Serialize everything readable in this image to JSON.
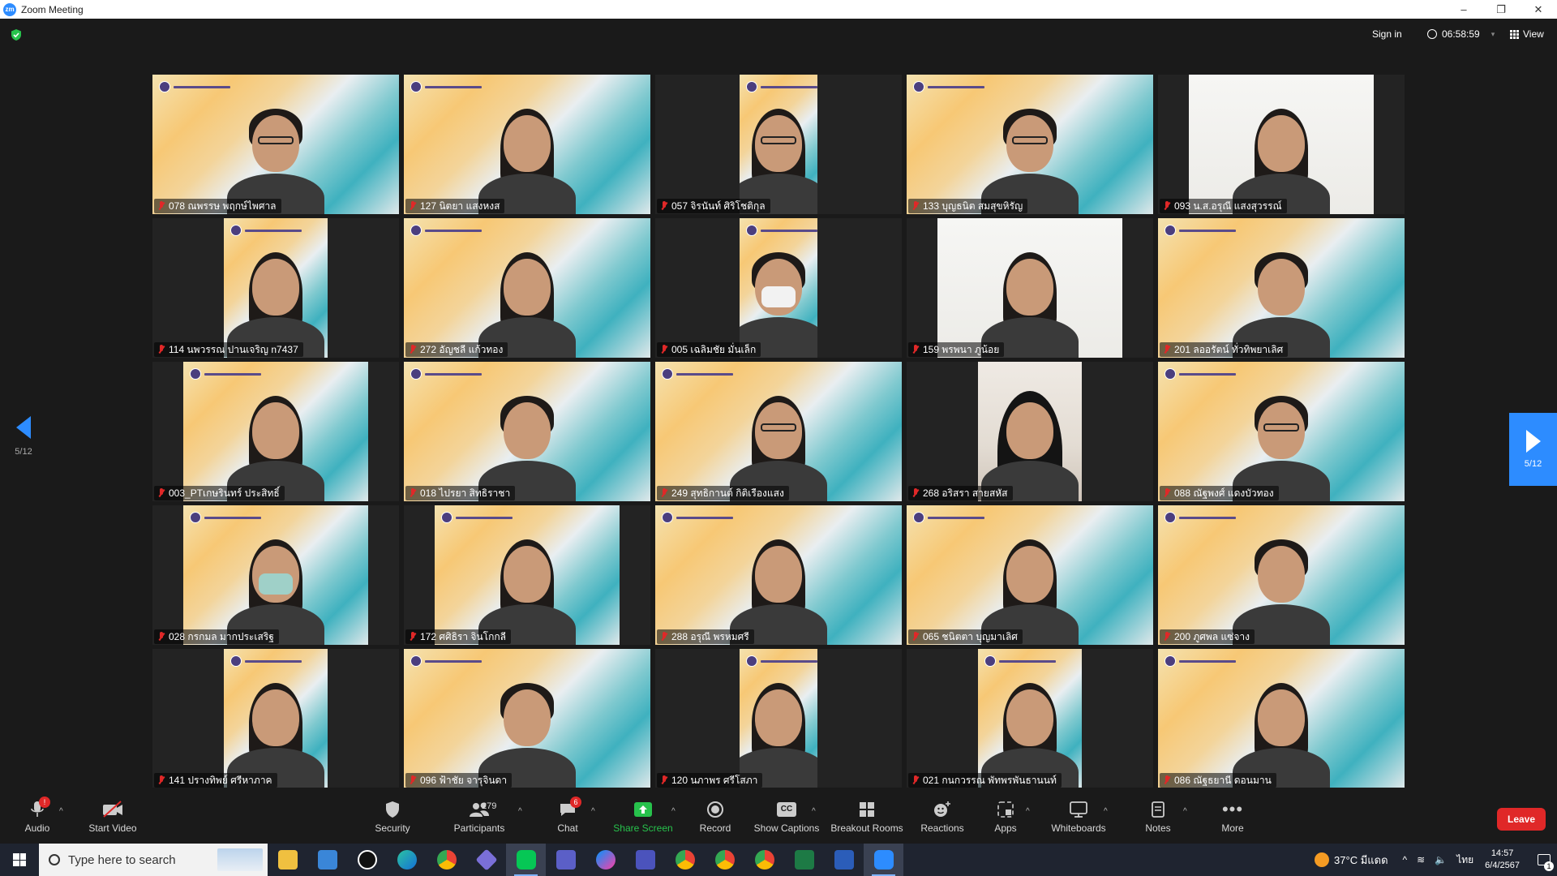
{
  "window": {
    "title": "Zoom Meeting",
    "app_icon_text": "zm"
  },
  "topbar": {
    "sign_in": "Sign in",
    "timer": "06:58:59",
    "view_label": "View"
  },
  "pagination": {
    "prev_label": "5/12",
    "next_label": "5/12"
  },
  "participants": [
    {
      "name": "078 ณพรรษ พฤกษ์ไพศาล",
      "bg": "zoom",
      "frame": "full",
      "look": "short glasses"
    },
    {
      "name": "127 นิตยา  แสงหงส",
      "bg": "zoom",
      "frame": "full",
      "look": "long"
    },
    {
      "name": "057 จิรนันท์ ศิริโชติกุล",
      "bg": "zoom",
      "frame": "narrow",
      "look": "long glasses"
    },
    {
      "name": "133 บุญธนิต สมสุขหิรัญ",
      "bg": "zoom",
      "frame": "full",
      "look": "short glasses"
    },
    {
      "name": "093 น.ส.อรุณี แสงสุวรรณ์",
      "bg": "white",
      "frame": "mid",
      "look": "long"
    },
    {
      "name": "114 นพวรรณ ปานเจริญ n7437",
      "bg": "zoom",
      "frame": "mid-sm",
      "look": "long"
    },
    {
      "name": "272 อัญชลี แก้วทอง",
      "bg": "zoom",
      "frame": "full",
      "look": "long"
    },
    {
      "name": "005 เฉลิมชัย มั่นเล็ก",
      "bg": "zoom",
      "frame": "narrow",
      "look": "short mask-white"
    },
    {
      "name": "159 พรพนา ภูน้อย",
      "bg": "white",
      "frame": "mid",
      "look": "long"
    },
    {
      "name": "201 ลออรัตน์ ทั่วทิพยาเลิศ",
      "bg": "zoom",
      "frame": "full",
      "look": "short"
    },
    {
      "name": "003_PTเกษรินทร์ ประสิทธิ์",
      "bg": "zoom",
      "frame": "mid",
      "look": "long"
    },
    {
      "name": "018 ไปรยา สิทธิราชา",
      "bg": "zoom",
      "frame": "full",
      "look": "short"
    },
    {
      "name": "249 สุทธิกานต์ กิติเรืองแสง",
      "bg": "zoom",
      "frame": "full",
      "look": "long glasses"
    },
    {
      "name": "268 อริสรา สายสหัส",
      "bg": "room",
      "frame": "narrow-lg",
      "look": "hijab"
    },
    {
      "name": "088 ณัฐพงศ์ แดงบัวทอง",
      "bg": "zoom",
      "frame": "full",
      "look": "short glasses"
    },
    {
      "name": "028 กรกมล มากประเสริฐ",
      "bg": "zoom",
      "frame": "mid",
      "look": "long mask"
    },
    {
      "name": "172 ศศิธิรา จินโกกลี",
      "bg": "zoom",
      "frame": "mid",
      "look": "long"
    },
    {
      "name": "288 อรุณี พรหมศรี",
      "bg": "zoom",
      "frame": "full",
      "look": "long"
    },
    {
      "name": "065 ชนิตตา บุญมาเลิศ",
      "bg": "zoom",
      "frame": "full",
      "look": "long"
    },
    {
      "name": "200 ภูศพล แซ่จาง",
      "bg": "zoom",
      "frame": "full",
      "look": "short"
    },
    {
      "name": "141 ปรางทิพย์ ศรีหาภาค",
      "bg": "zoom",
      "frame": "mid-sm",
      "look": "long"
    },
    {
      "name": "096 ฟ้าชัย จารุจินดา",
      "bg": "zoom",
      "frame": "full",
      "look": "short"
    },
    {
      "name": "120 นภาพร ศรีโสภา",
      "bg": "zoom",
      "frame": "narrow",
      "look": "long"
    },
    {
      "name": "021 กนกวรรณ พัทพรพันธานนท์",
      "bg": "zoom",
      "frame": "mid-sm",
      "look": "long"
    },
    {
      "name": "086 ณัฐธยานี ดอนมาน",
      "bg": "zoom",
      "frame": "full",
      "look": "long"
    }
  ],
  "toolbar": {
    "audio": "Audio",
    "audio_badge": "!",
    "start_video": "Start Video",
    "security": "Security",
    "participants": "Participants",
    "participants_count": "279",
    "chat": "Chat",
    "chat_badge": "6",
    "share_screen": "Share Screen",
    "record": "Record",
    "show_captions": "Show Captions",
    "cc_icon_text": "CC",
    "breakout_rooms": "Breakout Rooms",
    "reactions": "Reactions",
    "apps": "Apps",
    "whiteboards": "Whiteboards",
    "notes": "Notes",
    "more": "More",
    "leave": "Leave"
  },
  "taskbar": {
    "search_placeholder": "Type here to search",
    "weather": "37°C  มีแดด",
    "lang": "ไทย",
    "time": "14:57",
    "date": "6/4/2567",
    "notif_count": "1"
  },
  "colors": {
    "accent": "#2d8cff",
    "leave": "#e02828",
    "share": "#27c24c"
  }
}
